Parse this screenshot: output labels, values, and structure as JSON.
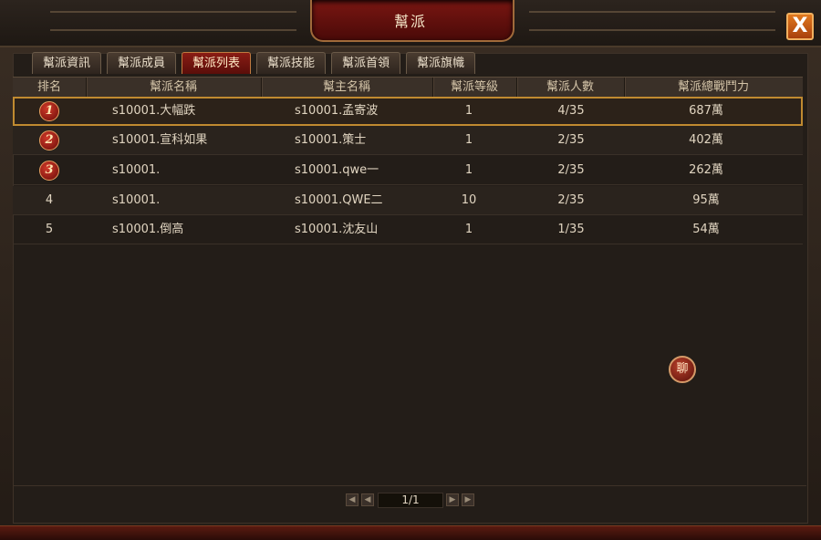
{
  "window": {
    "title": "幫派",
    "close_label": "X"
  },
  "tabs": [
    {
      "label": "幫派資訊",
      "active": false
    },
    {
      "label": "幫派成員",
      "active": false
    },
    {
      "label": "幫派列表",
      "active": true
    },
    {
      "label": "幫派技能",
      "active": false
    },
    {
      "label": "幫派首領",
      "active": false
    },
    {
      "label": "幫派旗幟",
      "active": false
    }
  ],
  "table": {
    "columns": [
      "排名",
      "幫派名稱",
      "幫主名稱",
      "幫派等級",
      "幫派人數",
      "幫派總戰鬥力"
    ],
    "rows": [
      {
        "rank": "1",
        "guild": "s10001.大幅跌",
        "leader": "s10001.孟寄波",
        "level": "1",
        "members": "4/35",
        "power": "687萬"
      },
      {
        "rank": "2",
        "guild": "s10001.宣科如果",
        "leader": "s10001.策士",
        "level": "1",
        "members": "2/35",
        "power": "402萬"
      },
      {
        "rank": "3",
        "guild": "s10001.",
        "leader": "s10001.qwe一",
        "level": "1",
        "members": "2/35",
        "power": "262萬"
      },
      {
        "rank": "4",
        "guild": "s10001.",
        "leader": "s10001.QWE二",
        "level": "10",
        "members": "2/35",
        "power": "95萬"
      },
      {
        "rank": "5",
        "guild": "s10001.倒高",
        "leader": "s10001.沈友山",
        "level": "1",
        "members": "1/35",
        "power": "54萬"
      }
    ]
  },
  "chat_button": {
    "label": "聊"
  },
  "pagination": {
    "page": "1/1"
  }
}
